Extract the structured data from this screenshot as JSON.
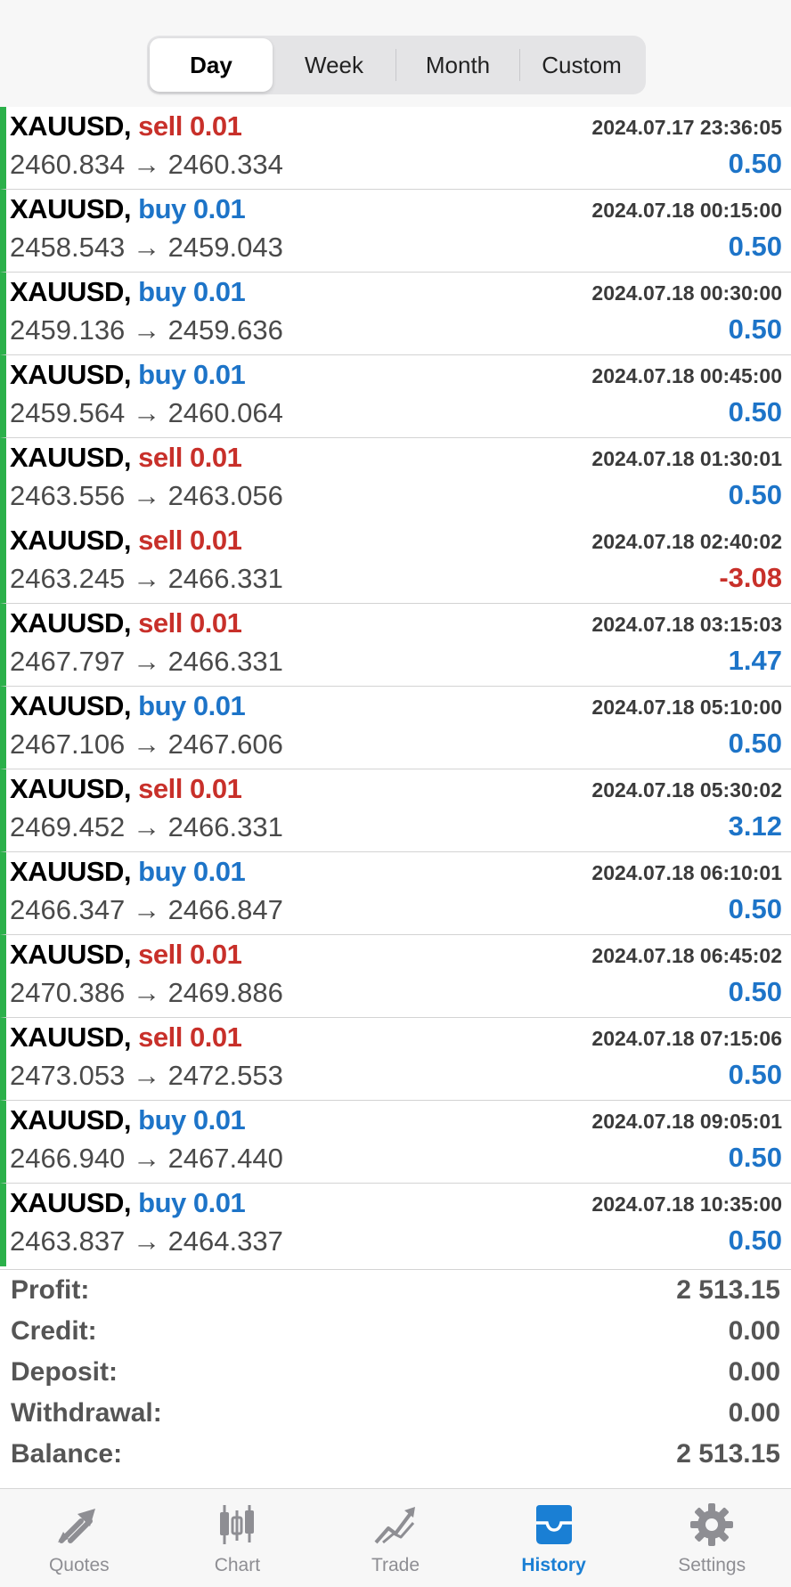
{
  "segments": [
    {
      "label": "Day",
      "active": true
    },
    {
      "label": "Week",
      "active": false
    },
    {
      "label": "Month",
      "active": false
    },
    {
      "label": "Custom",
      "active": false
    }
  ],
  "deals": [
    {
      "symbol": "XAUUSD,",
      "side": "sell",
      "volume": "0.01",
      "time": "2024.07.17 23:36:05",
      "open": "2460.834",
      "close": "2460.334",
      "arrow": "→",
      "profit": "0.50",
      "profit_sign": "pos"
    },
    {
      "symbol": "XAUUSD,",
      "side": "buy",
      "volume": "0.01",
      "time": "2024.07.18 00:15:00",
      "open": "2458.543",
      "close": "2459.043",
      "arrow": "→",
      "profit": "0.50",
      "profit_sign": "pos"
    },
    {
      "symbol": "XAUUSD,",
      "side": "buy",
      "volume": "0.01",
      "time": "2024.07.18 00:30:00",
      "open": "2459.136",
      "close": "2459.636",
      "arrow": "→",
      "profit": "0.50",
      "profit_sign": "pos"
    },
    {
      "symbol": "XAUUSD,",
      "side": "buy",
      "volume": "0.01",
      "time": "2024.07.18 00:45:00",
      "open": "2459.564",
      "close": "2460.064",
      "arrow": "→",
      "profit": "0.50",
      "profit_sign": "pos"
    },
    {
      "symbol": "XAUUSD,",
      "side": "sell",
      "volume": "0.01",
      "time": "2024.07.18 01:30:01",
      "open": "2463.556",
      "close": "2463.056",
      "arrow": "→",
      "profit": "0.50",
      "profit_sign": "pos"
    },
    {
      "symbol": "XAUUSD,",
      "side": "sell",
      "volume": "0.01",
      "time": "2024.07.18 02:40:02",
      "open": "2463.245",
      "close": "2466.331",
      "arrow": "→",
      "profit": "-3.08",
      "profit_sign": "neg"
    },
    {
      "symbol": "XAUUSD,",
      "side": "sell",
      "volume": "0.01",
      "time": "2024.07.18 03:15:03",
      "open": "2467.797",
      "close": "2466.331",
      "arrow": "→",
      "profit": "1.47",
      "profit_sign": "pos"
    },
    {
      "symbol": "XAUUSD,",
      "side": "buy",
      "volume": "0.01",
      "time": "2024.07.18 05:10:00",
      "open": "2467.106",
      "close": "2467.606",
      "arrow": "→",
      "profit": "0.50",
      "profit_sign": "pos"
    },
    {
      "symbol": "XAUUSD,",
      "side": "sell",
      "volume": "0.01",
      "time": "2024.07.18 05:30:02",
      "open": "2469.452",
      "close": "2466.331",
      "arrow": "→",
      "profit": "3.12",
      "profit_sign": "pos"
    },
    {
      "symbol": "XAUUSD,",
      "side": "buy",
      "volume": "0.01",
      "time": "2024.07.18 06:10:01",
      "open": "2466.347",
      "close": "2466.847",
      "arrow": "→",
      "profit": "0.50",
      "profit_sign": "pos"
    },
    {
      "symbol": "XAUUSD,",
      "side": "sell",
      "volume": "0.01",
      "time": "2024.07.18 06:45:02",
      "open": "2470.386",
      "close": "2469.886",
      "arrow": "→",
      "profit": "0.50",
      "profit_sign": "pos"
    },
    {
      "symbol": "XAUUSD,",
      "side": "sell",
      "volume": "0.01",
      "time": "2024.07.18 07:15:06",
      "open": "2473.053",
      "close": "2472.553",
      "arrow": "→",
      "profit": "0.50",
      "profit_sign": "pos"
    },
    {
      "symbol": "XAUUSD,",
      "side": "buy",
      "volume": "0.01",
      "time": "2024.07.18 09:05:01",
      "open": "2466.940",
      "close": "2467.440",
      "arrow": "→",
      "profit": "0.50",
      "profit_sign": "pos"
    },
    {
      "symbol": "XAUUSD,",
      "side": "buy",
      "volume": "0.01",
      "time": "2024.07.18 10:35:00",
      "open": "2463.837",
      "close": "2464.337",
      "arrow": "→",
      "profit": "0.50",
      "profit_sign": "pos"
    }
  ],
  "summary": [
    {
      "label": "Profit:",
      "value": "2 513.15"
    },
    {
      "label": "Credit:",
      "value": "0.00"
    },
    {
      "label": "Deposit:",
      "value": "0.00"
    },
    {
      "label": "Withdrawal:",
      "value": "0.00"
    },
    {
      "label": "Balance:",
      "value": "2 513.15"
    }
  ],
  "tabs": [
    {
      "label": "Quotes",
      "icon": "quotes-icon",
      "active": false
    },
    {
      "label": "Chart",
      "icon": "chart-icon",
      "active": false
    },
    {
      "label": "Trade",
      "icon": "trade-icon",
      "active": false
    },
    {
      "label": "History",
      "icon": "history-icon",
      "active": true
    },
    {
      "label": "Settings",
      "icon": "settings-icon",
      "active": false
    }
  ],
  "colors": {
    "sell": "#c8302a",
    "buy": "#1d74c8",
    "profit_positive": "#1d74c8",
    "profit_negative": "#c8302a",
    "row_marker": "#2bb04a",
    "tab_active": "#1a7fd4",
    "tab_inactive": "#8e8e93"
  }
}
